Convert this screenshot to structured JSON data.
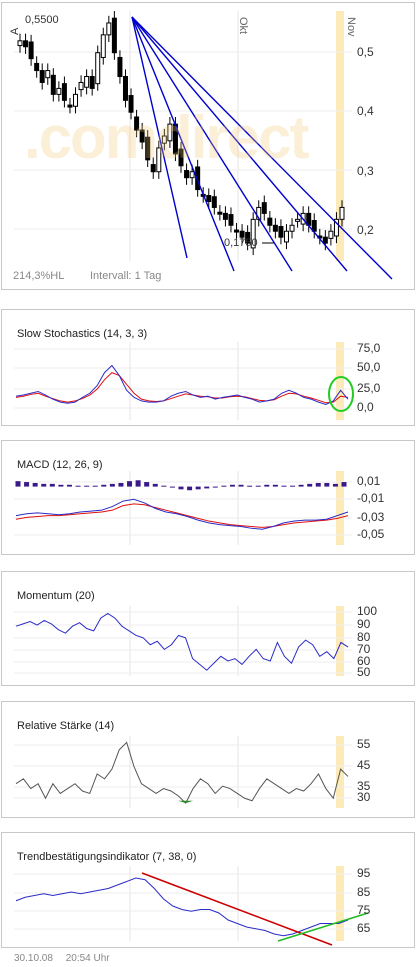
{
  "main": {
    "hi_label": "0,5500",
    "lo_label": "0,1750",
    "hl_label": "214,3%HL",
    "interval_label": "Intervall: 1 Tag",
    "month_labels": [
      "Okt",
      "Nov"
    ],
    "symbol_label": "A",
    "watermark": ".comdirect"
  },
  "footer": {
    "date": "30.10.08",
    "time": "20:54 Uhr"
  },
  "colors": {
    "fan": "#0000cc",
    "stoch_k": "#2b2bc8",
    "stoch_d": "#e01010",
    "highlight": "#fbe39a",
    "circle": "#22cc22",
    "trend_down": "#cc0000",
    "trend_up": "#22bb22",
    "macd_hist": "#3a1a8a",
    "rsi_fill": "#2a8a2a"
  },
  "chart_data": [
    {
      "type": "candlestick",
      "title": "",
      "x_labels": [
        "Okt",
        "Nov"
      ],
      "y_ticks": [
        "0,5",
        "0,4",
        "0,3",
        "0,2"
      ],
      "ylim": [
        0.15,
        0.56
      ],
      "high_annotation": 0.55,
      "low_annotation": 0.175,
      "close": [
        0.52,
        0.51,
        0.49,
        0.47,
        0.45,
        0.47,
        0.43,
        0.44,
        0.42,
        0.41,
        0.43,
        0.45,
        0.46,
        0.44,
        0.5,
        0.53,
        0.55,
        0.5,
        0.46,
        0.42,
        0.4,
        0.37,
        0.35,
        0.32,
        0.3,
        0.34,
        0.36,
        0.38,
        0.33,
        0.31,
        0.29,
        0.3,
        0.27,
        0.26,
        0.25,
        0.24,
        0.23,
        0.22,
        0.21,
        0.2,
        0.19,
        0.18,
        0.22,
        0.24,
        0.23,
        0.21,
        0.2,
        0.19,
        0.2,
        0.21,
        0.22,
        0.23,
        0.21,
        0.2,
        0.19,
        0.18,
        0.2,
        0.22,
        0.24
      ]
    },
    {
      "type": "line",
      "title": "Slow Stochastics (14, 3, 3)",
      "y_ticks": [
        "75,0",
        "50,0",
        "25,0",
        "0,0"
      ],
      "ylim": [
        0,
        100
      ],
      "series": [
        {
          "values": [
            20,
            22,
            25,
            28,
            22,
            15,
            10,
            8,
            10,
            18,
            25,
            38,
            60,
            72,
            55,
            30,
            18,
            12,
            10,
            10,
            12,
            20,
            25,
            28,
            22,
            18,
            20,
            15,
            18,
            20,
            22,
            18,
            15,
            10,
            12,
            15,
            25,
            30,
            25,
            18,
            15,
            10,
            6,
            12,
            30,
            15
          ]
        },
        {
          "values": [
            18,
            20,
            23,
            25,
            20,
            16,
            12,
            10,
            12,
            16,
            22,
            32,
            48,
            60,
            55,
            40,
            25,
            15,
            12,
            11,
            12,
            16,
            20,
            24,
            22,
            20,
            19,
            17,
            17,
            19,
            20,
            19,
            16,
            13,
            12,
            14,
            20,
            25,
            24,
            20,
            17,
            13,
            9,
            10,
            20,
            18
          ]
        }
      ]
    },
    {
      "type": "bar+line",
      "title": "MACD (12, 26, 9)",
      "y_ticks": [
        "0,01",
        "-0,01",
        "-0,03",
        "-0,05"
      ],
      "ylim": [
        -0.06,
        0.015
      ],
      "histogram": [
        0.006,
        0.005,
        0.004,
        0.003,
        0.003,
        0.002,
        0.002,
        0.001,
        0.001,
        0.001,
        0.002,
        0.003,
        0.004,
        0.006,
        0.007,
        0.005,
        0.003,
        0.001,
        -0.001,
        -0.003,
        -0.004,
        -0.003,
        -0.002,
        -0.001,
        0.001,
        0.002,
        0.002,
        0.001,
        0.001,
        0.002,
        0.002,
        0.001,
        0.001,
        0.002,
        0.003,
        0.004,
        0.004,
        0.003,
        0.005
      ],
      "series": [
        {
          "values": [
            -0.032,
            -0.03,
            -0.029,
            -0.03,
            -0.031,
            -0.03,
            -0.028,
            -0.027,
            -0.026,
            -0.022,
            -0.016,
            -0.014,
            -0.018,
            -0.024,
            -0.028,
            -0.03,
            -0.033,
            -0.037,
            -0.04,
            -0.042,
            -0.043,
            -0.044,
            -0.046,
            -0.047,
            -0.044,
            -0.04,
            -0.038,
            -0.037,
            -0.037,
            -0.036,
            -0.032,
            -0.028
          ]
        },
        {
          "values": [
            -0.036,
            -0.034,
            -0.033,
            -0.032,
            -0.032,
            -0.031,
            -0.03,
            -0.029,
            -0.028,
            -0.026,
            -0.021,
            -0.019,
            -0.02,
            -0.023,
            -0.026,
            -0.029,
            -0.032,
            -0.035,
            -0.038,
            -0.04,
            -0.042,
            -0.043,
            -0.044,
            -0.045,
            -0.044,
            -0.042,
            -0.04,
            -0.039,
            -0.038,
            -0.037,
            -0.035,
            -0.032
          ]
        }
      ]
    },
    {
      "type": "line",
      "title": "Momentum (20)",
      "y_ticks": [
        "100",
        "90",
        "80",
        "70",
        "60",
        "50"
      ],
      "ylim": [
        45,
        102
      ],
      "series": [
        {
          "values": [
            88,
            90,
            92,
            89,
            93,
            90,
            85,
            82,
            88,
            91,
            86,
            84,
            95,
            99,
            95,
            88,
            84,
            80,
            78,
            72,
            75,
            68,
            72,
            80,
            78,
            60,
            55,
            50,
            56,
            62,
            58,
            60,
            55,
            62,
            68,
            60,
            58,
            74,
            62,
            56,
            70,
            76,
            72,
            62,
            66,
            60,
            74,
            70
          ]
        }
      ]
    },
    {
      "type": "line",
      "title": "Relative Stärke (14)",
      "y_ticks": [
        "55",
        "45",
        "35",
        "30"
      ],
      "ylim": [
        28,
        56
      ],
      "series": [
        {
          "values": [
            38,
            40,
            36,
            38,
            32,
            38,
            34,
            36,
            38,
            35,
            34,
            42,
            40,
            44,
            52,
            55,
            45,
            38,
            36,
            34,
            36,
            35,
            33,
            30,
            36,
            40,
            38,
            34,
            37,
            36,
            34,
            32,
            31,
            36,
            40,
            38,
            36,
            34,
            36,
            35,
            38,
            42,
            36,
            32,
            44,
            41
          ]
        }
      ]
    },
    {
      "type": "line",
      "title": "Trendbestätigungsindikator (7, 38, 0)",
      "y_ticks": [
        "95",
        "85",
        "75",
        "65"
      ],
      "ylim": [
        60,
        100
      ],
      "series": [
        {
          "values": [
            83,
            85,
            86,
            87,
            86,
            87,
            88,
            87,
            88,
            89,
            90,
            92,
            94,
            96,
            95,
            90,
            84,
            80,
            78,
            77,
            78,
            78,
            76,
            72,
            70,
            68,
            67,
            66,
            64,
            63,
            64,
            66,
            68,
            70,
            70,
            70,
            72
          ]
        }
      ]
    }
  ]
}
